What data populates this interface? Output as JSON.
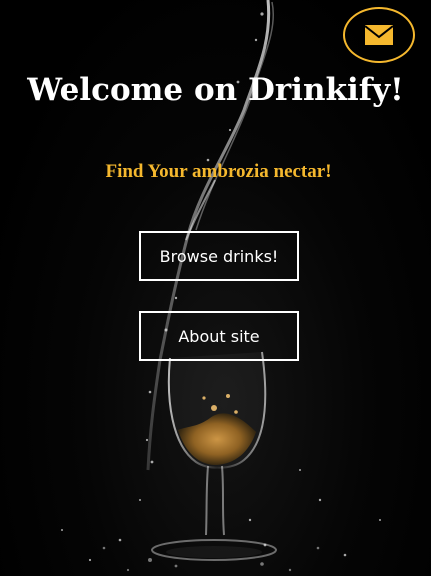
{
  "header": {
    "mail_icon": "envelope-icon",
    "accent_color": "#f5b82e"
  },
  "hero": {
    "title": "Welcome on Drinkify!",
    "tagline": "Find Your ambrozia nectar!"
  },
  "actions": {
    "browse_label": "Browse drinks!",
    "about_label": "About site"
  }
}
